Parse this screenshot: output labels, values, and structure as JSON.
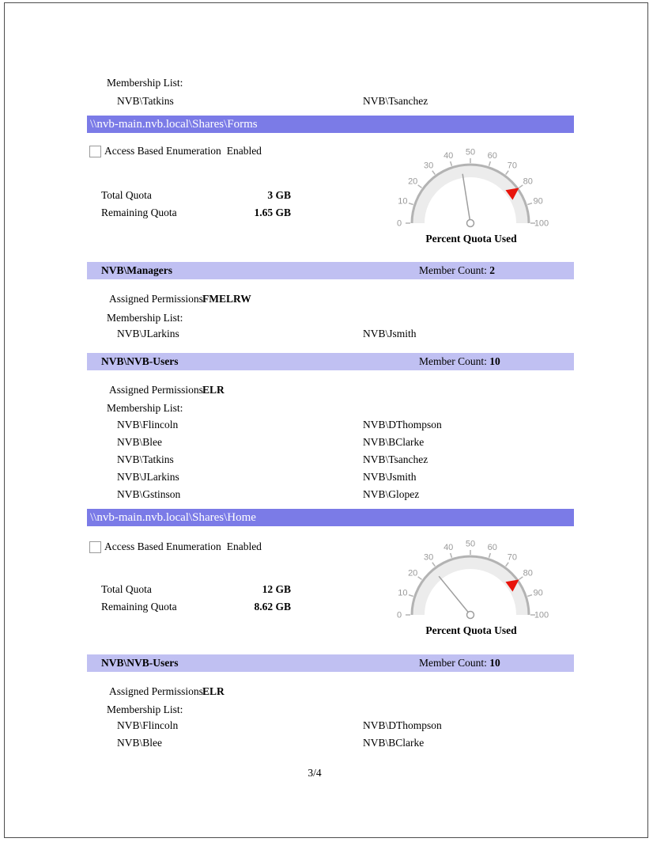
{
  "report": {
    "page_label": "3/4",
    "labels": {
      "abe": "Access Based Enumeration",
      "abe_state": "Enabled",
      "total_quota": "Total Quota",
      "remaining_quota": "Remaining Quota",
      "assigned_permissions": "Assigned Permissions",
      "membership": "Membership List:",
      "member_count": "Member Count:",
      "gauge_title": "Percent Quota Used"
    },
    "colors": {
      "share_bar": "#7b7be7",
      "group_bar": "#c0c0f2",
      "gauge_band": "#ececec",
      "gauge_stroke": "#b3b3b3",
      "gauge_label": "#999999",
      "needle": "#9e9e9e",
      "marker_red": "#e8140b"
    },
    "carryover": {
      "members_left": [
        "NVB\\Tatkins"
      ],
      "members_right": [
        "NVB\\Tsanchez"
      ]
    },
    "shares": [
      {
        "path": "\\\\nvb-main.nvb.local\\Shares\\Forms",
        "abe_checked": false,
        "total_quota": "3 GB",
        "remaining_quota": "1.65 GB",
        "groups": [
          {
            "name": "NVB\\Managers",
            "member_count": "2",
            "permissions": "FMELRW",
            "members_left": [
              "NVB\\JLarkins"
            ],
            "members_right": [
              "NVB\\Jsmith"
            ]
          },
          {
            "name": "NVB\\NVB-Users",
            "member_count": "10",
            "permissions": "ELR",
            "members_left": [
              "NVB\\Flincoln",
              "NVB\\Blee",
              "NVB\\Tatkins",
              "NVB\\JLarkins",
              "NVB\\Gstinson"
            ],
            "members_right": [
              "NVB\\DThompson",
              "NVB\\BClarke",
              "NVB\\Tsanchez",
              "NVB\\Jsmith",
              "NVB\\Glopez"
            ]
          }
        ]
      },
      {
        "path": "\\\\nvb-main.nvb.local\\Shares\\Home",
        "abe_checked": false,
        "total_quota": "12 GB",
        "remaining_quota": "8.62 GB",
        "groups": [
          {
            "name": "NVB\\NVB-Users",
            "member_count": "10",
            "permissions": "ELR",
            "members_left": [
              "NVB\\Flincoln",
              "NVB\\Blee"
            ],
            "members_right": [
              "NVB\\DThompson",
              "NVB\\BClarke"
            ]
          }
        ]
      }
    ]
  },
  "chart_data": [
    {
      "type": "gauge",
      "title": "Percent Quota Used",
      "min": 0,
      "max": 100,
      "tick_interval": 10,
      "tick_labels": [
        0,
        10,
        20,
        30,
        40,
        50,
        60,
        70,
        80,
        90,
        100
      ],
      "value": 45,
      "threshold_marker": 80,
      "share": "\\\\nvb-main.nvb.local\\Shares\\Forms"
    },
    {
      "type": "gauge",
      "title": "Percent Quota Used",
      "min": 0,
      "max": 100,
      "tick_interval": 10,
      "tick_labels": [
        0,
        10,
        20,
        30,
        40,
        50,
        60,
        70,
        80,
        90,
        100
      ],
      "value": 28.2,
      "threshold_marker": 80,
      "share": "\\\\nvb-main.nvb.local\\Shares\\Home"
    }
  ]
}
